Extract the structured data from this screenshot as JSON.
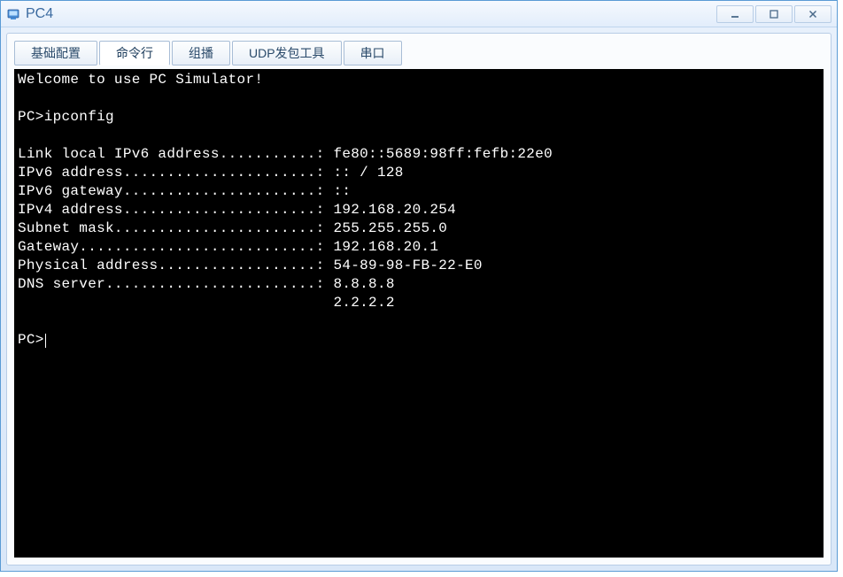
{
  "window": {
    "title": "PC4"
  },
  "tabs": [
    {
      "label": "基础配置",
      "active": false
    },
    {
      "label": "命令行",
      "active": true
    },
    {
      "label": "组播",
      "active": false
    },
    {
      "label": "UDP发包工具",
      "active": false
    },
    {
      "label": "串口",
      "active": false
    }
  ],
  "terminal": {
    "welcome": "Welcome to use PC Simulator!",
    "prompt1": "PC>ipconfig",
    "lines": [
      "",
      "Link local IPv6 address...........: fe80::5689:98ff:fefb:22e0",
      "IPv6 address......................: :: / 128",
      "IPv6 gateway......................: ::",
      "IPv4 address......................: 192.168.20.254",
      "Subnet mask.......................: 255.255.255.0",
      "Gateway...........................: 192.168.20.1",
      "Physical address..................: 54-89-98-FB-22-E0",
      "DNS server........................: 8.8.8.8",
      "                                    2.2.2.2",
      ""
    ],
    "prompt2": "PC>"
  }
}
